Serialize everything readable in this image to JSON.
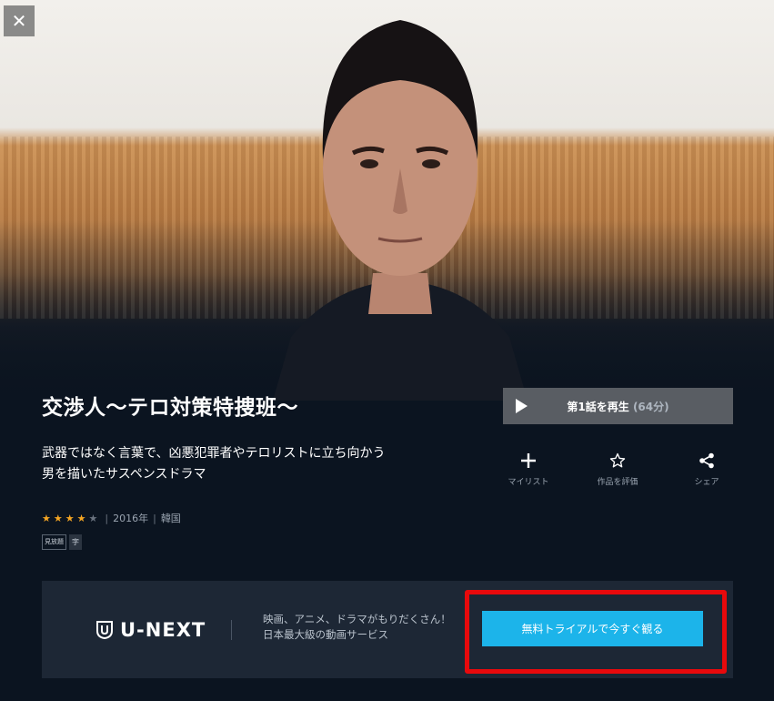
{
  "hero": {
    "close_icon": "close-icon"
  },
  "title": "交渉人～テロ対策特捜班～",
  "play": {
    "label": "第1話を再生",
    "duration": "(64分)"
  },
  "description": [
    "武器ではなく言葉で、凶悪犯罪者やテロリストに立ち向かう",
    "男を描いたサスペンスドラマ"
  ],
  "actions": [
    {
      "icon": "plus-icon",
      "label": "マイリスト"
    },
    {
      "icon": "star-outline-icon",
      "label": "作品を評価"
    },
    {
      "icon": "share-icon",
      "label": "シェア"
    }
  ],
  "meta": {
    "rating": 4,
    "rating_max": 5,
    "year": "2016年",
    "country": "韓国"
  },
  "badges": [
    "見放題",
    "字"
  ],
  "promo": {
    "logo": "U-NEXT",
    "tagline": [
      "映画、アニメ、ドラマがもりだくさん！",
      "日本最大級の動画サービス"
    ],
    "cta": "無料トライアルで今すぐ観る"
  },
  "colors": {
    "accent": "#1cb4ea",
    "highlight": "#e8090c",
    "star": "#f5a623"
  }
}
